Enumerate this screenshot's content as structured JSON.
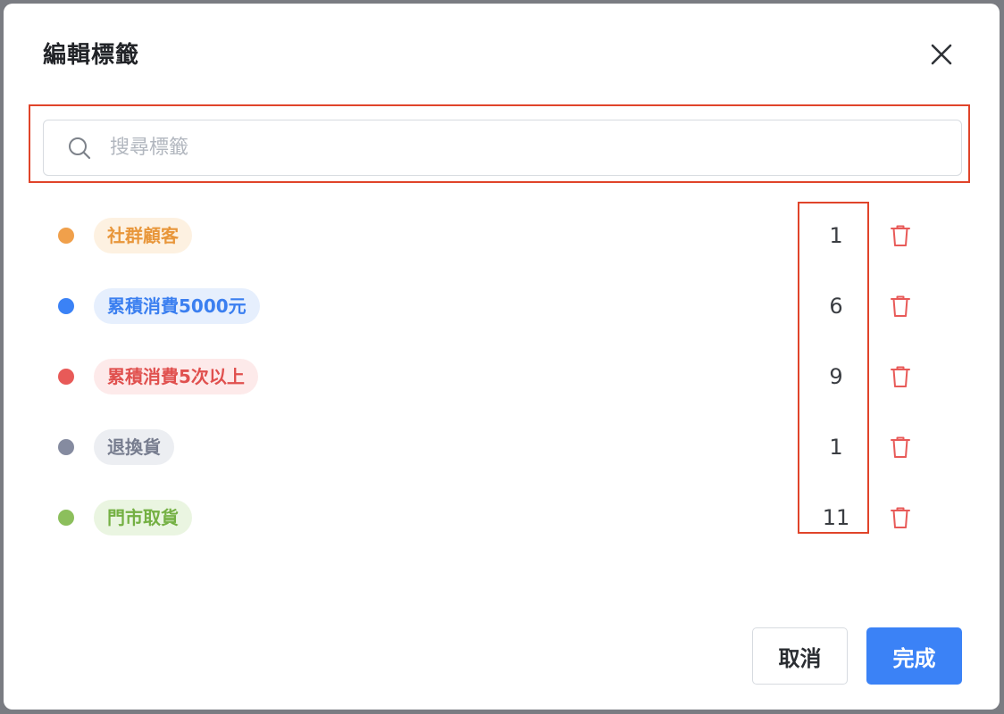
{
  "dialog": {
    "title": "編輯標籤",
    "close_icon": "close-icon"
  },
  "search": {
    "placeholder": "搜尋標籤",
    "value": "",
    "icon": "search-icon"
  },
  "tags": [
    {
      "label": "社群顧客",
      "count": "1",
      "dot_color": "#f0a04b",
      "text_color": "#e8963a",
      "bg_color": "#fdf1e1"
    },
    {
      "label": "累積消費5000元",
      "count": "6",
      "dot_color": "#3b82f6",
      "text_color": "#3b7ff0",
      "bg_color": "#e6effd"
    },
    {
      "label": "累積消費5次以上",
      "count": "9",
      "dot_color": "#e85a58",
      "text_color": "#e0504e",
      "bg_color": "#fdeaea"
    },
    {
      "label": "退換貨",
      "count": "1",
      "dot_color": "#858ba0",
      "text_color": "#767c8e",
      "bg_color": "#eceef2"
    },
    {
      "label": "門市取貨",
      "count": "11",
      "dot_color": "#8cbf5c",
      "text_color": "#74b043",
      "bg_color": "#eaf5e1"
    }
  ],
  "row_action_icon": "trash-icon",
  "actions": {
    "cancel_label": "取消",
    "done_label": "完成"
  },
  "colors": {
    "primary": "#3b82f6",
    "highlight": "#e0442a",
    "danger": "#e85a58"
  }
}
